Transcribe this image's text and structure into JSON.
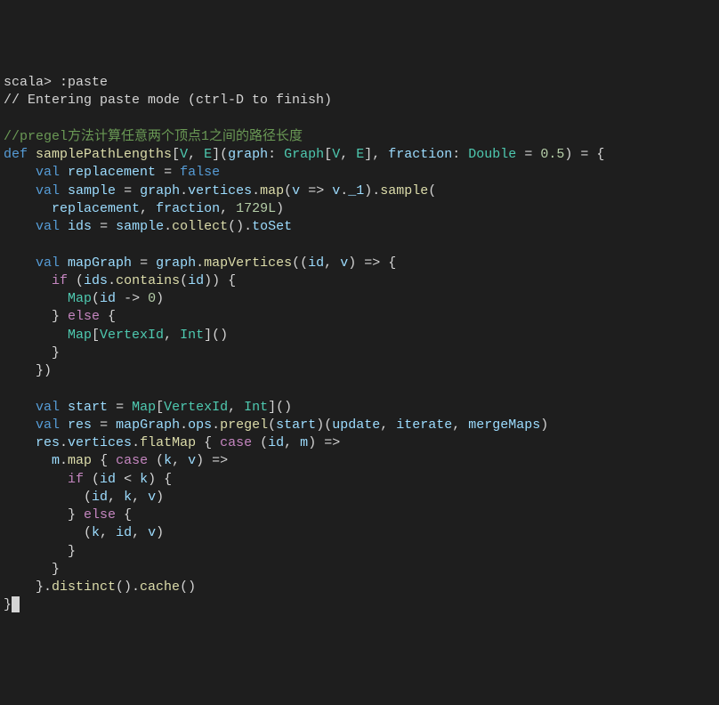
{
  "terminal": {
    "prompt": "scala> ",
    "cmd": ":paste",
    "paste_mode_msg": "// Entering paste mode (ctrl-D to finish)",
    "lines": [
      {
        "t": "comment",
        "s": "//pregel方法计算任意两个顶点1之间的路径长度"
      },
      {
        "t": "code",
        "parts": [
          {
            "c": "keyword-blue",
            "s": "def"
          },
          {
            "c": "nocolor",
            "s": " "
          },
          {
            "c": "func",
            "s": "samplePathLengths"
          },
          {
            "c": "nocolor",
            "s": "["
          },
          {
            "c": "type",
            "s": "V"
          },
          {
            "c": "nocolor",
            "s": ", "
          },
          {
            "c": "type",
            "s": "E"
          },
          {
            "c": "nocolor",
            "s": "]("
          },
          {
            "c": "var-light",
            "s": "graph"
          },
          {
            "c": "nocolor",
            "s": ": "
          },
          {
            "c": "type",
            "s": "Graph"
          },
          {
            "c": "nocolor",
            "s": "["
          },
          {
            "c": "type",
            "s": "V"
          },
          {
            "c": "nocolor",
            "s": ", "
          },
          {
            "c": "type",
            "s": "E"
          },
          {
            "c": "nocolor",
            "s": "], "
          },
          {
            "c": "var-light",
            "s": "fraction"
          },
          {
            "c": "nocolor",
            "s": ": "
          },
          {
            "c": "type",
            "s": "Double"
          },
          {
            "c": "nocolor",
            "s": " = "
          },
          {
            "c": "number",
            "s": "0.5"
          },
          {
            "c": "nocolor",
            "s": ") = {"
          }
        ]
      },
      {
        "t": "code",
        "parts": [
          {
            "c": "nocolor",
            "s": "    "
          },
          {
            "c": "keyword-blue",
            "s": "val"
          },
          {
            "c": "nocolor",
            "s": " "
          },
          {
            "c": "var-light",
            "s": "replacement"
          },
          {
            "c": "nocolor",
            "s": " = "
          },
          {
            "c": "literal",
            "s": "false"
          }
        ]
      },
      {
        "t": "code",
        "parts": [
          {
            "c": "nocolor",
            "s": "    "
          },
          {
            "c": "keyword-blue",
            "s": "val"
          },
          {
            "c": "nocolor",
            "s": " "
          },
          {
            "c": "var-light",
            "s": "sample"
          },
          {
            "c": "nocolor",
            "s": " = "
          },
          {
            "c": "var-light",
            "s": "graph"
          },
          {
            "c": "nocolor",
            "s": "."
          },
          {
            "c": "var-light",
            "s": "vertices"
          },
          {
            "c": "nocolor",
            "s": "."
          },
          {
            "c": "func",
            "s": "map"
          },
          {
            "c": "nocolor",
            "s": "("
          },
          {
            "c": "var-light",
            "s": "v"
          },
          {
            "c": "nocolor",
            "s": " => "
          },
          {
            "c": "var-light",
            "s": "v"
          },
          {
            "c": "nocolor",
            "s": "."
          },
          {
            "c": "var-light",
            "s": "_1"
          },
          {
            "c": "nocolor",
            "s": ")."
          },
          {
            "c": "func",
            "s": "sample"
          },
          {
            "c": "nocolor",
            "s": "("
          }
        ]
      },
      {
        "t": "code",
        "parts": [
          {
            "c": "nocolor",
            "s": "      "
          },
          {
            "c": "var-light",
            "s": "replacement"
          },
          {
            "c": "nocolor",
            "s": ", "
          },
          {
            "c": "var-light",
            "s": "fraction"
          },
          {
            "c": "nocolor",
            "s": ", "
          },
          {
            "c": "number",
            "s": "1729L"
          },
          {
            "c": "nocolor",
            "s": ")"
          }
        ]
      },
      {
        "t": "code",
        "parts": [
          {
            "c": "nocolor",
            "s": "    "
          },
          {
            "c": "keyword-blue",
            "s": "val"
          },
          {
            "c": "nocolor",
            "s": " "
          },
          {
            "c": "var-light",
            "s": "ids"
          },
          {
            "c": "nocolor",
            "s": " = "
          },
          {
            "c": "var-light",
            "s": "sample"
          },
          {
            "c": "nocolor",
            "s": "."
          },
          {
            "c": "func",
            "s": "collect"
          },
          {
            "c": "nocolor",
            "s": "()."
          },
          {
            "c": "var-light",
            "s": "toSet"
          }
        ]
      },
      {
        "t": "blank",
        "s": ""
      },
      {
        "t": "code",
        "parts": [
          {
            "c": "nocolor",
            "s": "    "
          },
          {
            "c": "keyword-blue",
            "s": "val"
          },
          {
            "c": "nocolor",
            "s": " "
          },
          {
            "c": "var-light",
            "s": "mapGraph"
          },
          {
            "c": "nocolor",
            "s": " = "
          },
          {
            "c": "var-light",
            "s": "graph"
          },
          {
            "c": "nocolor",
            "s": "."
          },
          {
            "c": "func",
            "s": "mapVertices"
          },
          {
            "c": "nocolor",
            "s": "(("
          },
          {
            "c": "var-light",
            "s": "id"
          },
          {
            "c": "nocolor",
            "s": ", "
          },
          {
            "c": "var-light",
            "s": "v"
          },
          {
            "c": "nocolor",
            "s": ") => {"
          }
        ]
      },
      {
        "t": "code",
        "parts": [
          {
            "c": "nocolor",
            "s": "      "
          },
          {
            "c": "keyword",
            "s": "if"
          },
          {
            "c": "nocolor",
            "s": " ("
          },
          {
            "c": "var-light",
            "s": "ids"
          },
          {
            "c": "nocolor",
            "s": "."
          },
          {
            "c": "func",
            "s": "contains"
          },
          {
            "c": "nocolor",
            "s": "("
          },
          {
            "c": "var-light",
            "s": "id"
          },
          {
            "c": "nocolor",
            "s": ")) {"
          }
        ]
      },
      {
        "t": "code",
        "parts": [
          {
            "c": "nocolor",
            "s": "        "
          },
          {
            "c": "type",
            "s": "Map"
          },
          {
            "c": "nocolor",
            "s": "("
          },
          {
            "c": "var-light",
            "s": "id"
          },
          {
            "c": "nocolor",
            "s": " -> "
          },
          {
            "c": "number",
            "s": "0"
          },
          {
            "c": "nocolor",
            "s": ")"
          }
        ]
      },
      {
        "t": "code",
        "parts": [
          {
            "c": "nocolor",
            "s": "      } "
          },
          {
            "c": "keyword",
            "s": "else"
          },
          {
            "c": "nocolor",
            "s": " {"
          }
        ]
      },
      {
        "t": "code",
        "parts": [
          {
            "c": "nocolor",
            "s": "        "
          },
          {
            "c": "type",
            "s": "Map"
          },
          {
            "c": "nocolor",
            "s": "["
          },
          {
            "c": "type",
            "s": "VertexId"
          },
          {
            "c": "nocolor",
            "s": ", "
          },
          {
            "c": "type",
            "s": "Int"
          },
          {
            "c": "nocolor",
            "s": "]()"
          }
        ]
      },
      {
        "t": "code",
        "parts": [
          {
            "c": "nocolor",
            "s": "      }"
          }
        ]
      },
      {
        "t": "code",
        "parts": [
          {
            "c": "nocolor",
            "s": "    })"
          }
        ]
      },
      {
        "t": "blank",
        "s": ""
      },
      {
        "t": "code",
        "parts": [
          {
            "c": "nocolor",
            "s": "    "
          },
          {
            "c": "keyword-blue",
            "s": "val"
          },
          {
            "c": "nocolor",
            "s": " "
          },
          {
            "c": "var-light",
            "s": "start"
          },
          {
            "c": "nocolor",
            "s": " = "
          },
          {
            "c": "type",
            "s": "Map"
          },
          {
            "c": "nocolor",
            "s": "["
          },
          {
            "c": "type",
            "s": "VertexId"
          },
          {
            "c": "nocolor",
            "s": ", "
          },
          {
            "c": "type",
            "s": "Int"
          },
          {
            "c": "nocolor",
            "s": "]()"
          }
        ]
      },
      {
        "t": "code",
        "parts": [
          {
            "c": "nocolor",
            "s": "    "
          },
          {
            "c": "keyword-blue",
            "s": "val"
          },
          {
            "c": "nocolor",
            "s": " "
          },
          {
            "c": "var-light",
            "s": "res"
          },
          {
            "c": "nocolor",
            "s": " = "
          },
          {
            "c": "var-light",
            "s": "mapGraph"
          },
          {
            "c": "nocolor",
            "s": "."
          },
          {
            "c": "var-light",
            "s": "ops"
          },
          {
            "c": "nocolor",
            "s": "."
          },
          {
            "c": "func",
            "s": "pregel"
          },
          {
            "c": "nocolor",
            "s": "("
          },
          {
            "c": "var-light",
            "s": "start"
          },
          {
            "c": "nocolor",
            "s": ")("
          },
          {
            "c": "var-light",
            "s": "update"
          },
          {
            "c": "nocolor",
            "s": ", "
          },
          {
            "c": "var-light",
            "s": "iterate"
          },
          {
            "c": "nocolor",
            "s": ", "
          },
          {
            "c": "var-light",
            "s": "mergeMaps"
          },
          {
            "c": "nocolor",
            "s": ")"
          }
        ]
      },
      {
        "t": "code",
        "parts": [
          {
            "c": "nocolor",
            "s": "    "
          },
          {
            "c": "var-light",
            "s": "res"
          },
          {
            "c": "nocolor",
            "s": "."
          },
          {
            "c": "var-light",
            "s": "vertices"
          },
          {
            "c": "nocolor",
            "s": "."
          },
          {
            "c": "func",
            "s": "flatMap"
          },
          {
            "c": "nocolor",
            "s": " { "
          },
          {
            "c": "keyword",
            "s": "case"
          },
          {
            "c": "nocolor",
            "s": " ("
          },
          {
            "c": "var-light",
            "s": "id"
          },
          {
            "c": "nocolor",
            "s": ", "
          },
          {
            "c": "var-light",
            "s": "m"
          },
          {
            "c": "nocolor",
            "s": ") =>"
          }
        ]
      },
      {
        "t": "code",
        "parts": [
          {
            "c": "nocolor",
            "s": "      "
          },
          {
            "c": "var-light",
            "s": "m"
          },
          {
            "c": "nocolor",
            "s": "."
          },
          {
            "c": "func",
            "s": "map"
          },
          {
            "c": "nocolor",
            "s": " { "
          },
          {
            "c": "keyword",
            "s": "case"
          },
          {
            "c": "nocolor",
            "s": " ("
          },
          {
            "c": "var-light",
            "s": "k"
          },
          {
            "c": "nocolor",
            "s": ", "
          },
          {
            "c": "var-light",
            "s": "v"
          },
          {
            "c": "nocolor",
            "s": ") =>"
          }
        ]
      },
      {
        "t": "code",
        "parts": [
          {
            "c": "nocolor",
            "s": "        "
          },
          {
            "c": "keyword",
            "s": "if"
          },
          {
            "c": "nocolor",
            "s": " ("
          },
          {
            "c": "var-light",
            "s": "id"
          },
          {
            "c": "nocolor",
            "s": " < "
          },
          {
            "c": "var-light",
            "s": "k"
          },
          {
            "c": "nocolor",
            "s": ") {"
          }
        ]
      },
      {
        "t": "code",
        "parts": [
          {
            "c": "nocolor",
            "s": "          ("
          },
          {
            "c": "var-light",
            "s": "id"
          },
          {
            "c": "nocolor",
            "s": ", "
          },
          {
            "c": "var-light",
            "s": "k"
          },
          {
            "c": "nocolor",
            "s": ", "
          },
          {
            "c": "var-light",
            "s": "v"
          },
          {
            "c": "nocolor",
            "s": ")"
          }
        ]
      },
      {
        "t": "code",
        "parts": [
          {
            "c": "nocolor",
            "s": "        } "
          },
          {
            "c": "keyword",
            "s": "else"
          },
          {
            "c": "nocolor",
            "s": " {"
          }
        ]
      },
      {
        "t": "code",
        "parts": [
          {
            "c": "nocolor",
            "s": "          ("
          },
          {
            "c": "var-light",
            "s": "k"
          },
          {
            "c": "nocolor",
            "s": ", "
          },
          {
            "c": "var-light",
            "s": "id"
          },
          {
            "c": "nocolor",
            "s": ", "
          },
          {
            "c": "var-light",
            "s": "v"
          },
          {
            "c": "nocolor",
            "s": ")"
          }
        ]
      },
      {
        "t": "code",
        "parts": [
          {
            "c": "nocolor",
            "s": "        }"
          }
        ]
      },
      {
        "t": "code",
        "parts": [
          {
            "c": "nocolor",
            "s": "      }"
          }
        ]
      },
      {
        "t": "code",
        "parts": [
          {
            "c": "nocolor",
            "s": "    }."
          },
          {
            "c": "func",
            "s": "distinct"
          },
          {
            "c": "nocolor",
            "s": "()."
          },
          {
            "c": "func",
            "s": "cache"
          },
          {
            "c": "nocolor",
            "s": "()"
          }
        ]
      },
      {
        "t": "cursor",
        "s": "}"
      }
    ]
  }
}
